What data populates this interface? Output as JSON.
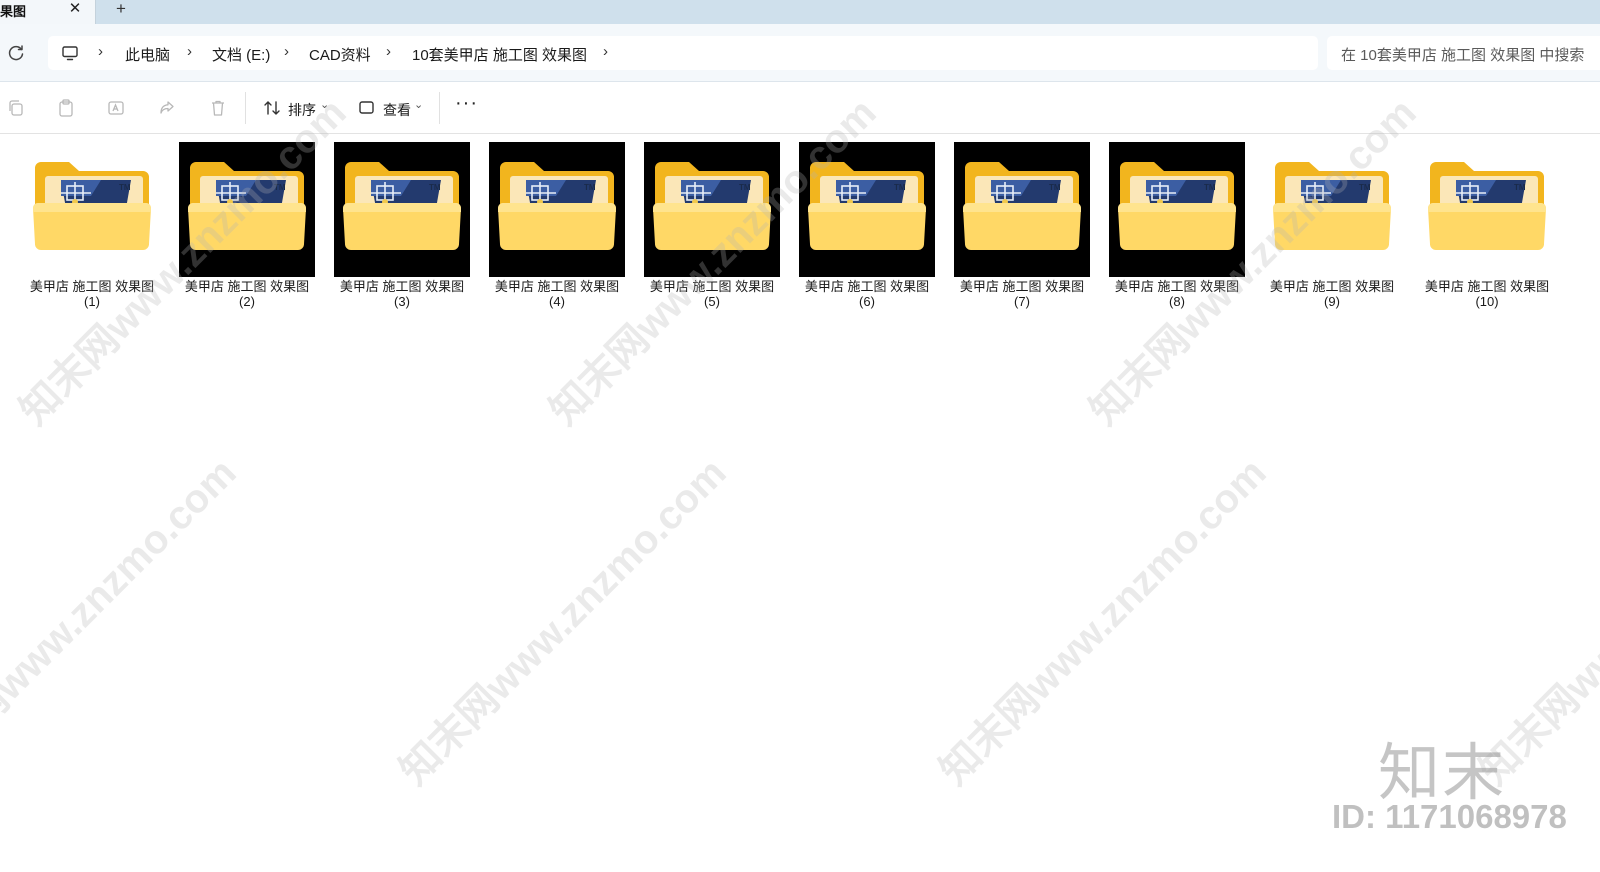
{
  "tab": {
    "title": "果图",
    "close_glyph": "✕",
    "new_tab_glyph": "+"
  },
  "address": {
    "refresh_glyph": "↻",
    "breadcrumbs": [
      "此电脑",
      "文档 (E:)",
      "CAD资料",
      "10套美甲店 施工图 效果图"
    ],
    "separator": "›"
  },
  "search": {
    "placeholder": "在 10套美甲店 施工图 效果图 中搜索"
  },
  "toolbar": {
    "sort_label": "排序",
    "view_label": "查看",
    "chevron": "⌄",
    "more_label": "···"
  },
  "items": [
    {
      "name": "美甲店 施工图 效果图",
      "index": "(1)",
      "dark": false
    },
    {
      "name": "美甲店 施工图 效果图",
      "index": "(2)",
      "dark": true
    },
    {
      "name": "美甲店 施工图 效果图",
      "index": "(3)",
      "dark": true
    },
    {
      "name": "美甲店 施工图 效果图",
      "index": "(4)",
      "dark": true
    },
    {
      "name": "美甲店 施工图 效果图",
      "index": "(5)",
      "dark": true
    },
    {
      "name": "美甲店 施工图 效果图",
      "index": "(6)",
      "dark": true
    },
    {
      "name": "美甲店 施工图 效果图",
      "index": "(7)",
      "dark": true
    },
    {
      "name": "美甲店 施工图 效果图",
      "index": "(8)",
      "dark": true
    },
    {
      "name": "美甲店 施工图 效果图",
      "index": "(9)",
      "dark": false
    },
    {
      "name": "美甲店 施工图 效果图",
      "index": "(10)",
      "dark": false
    }
  ],
  "watermark": {
    "text": "知末网www.znzmo.com",
    "logo": "知末",
    "id_text": "ID: 1171068978"
  },
  "colors": {
    "folder_back": "#f2b51e",
    "folder_front": "#ffd866",
    "autocad_badge": "#233a6e",
    "tab_strip": "#cfe0ec"
  }
}
